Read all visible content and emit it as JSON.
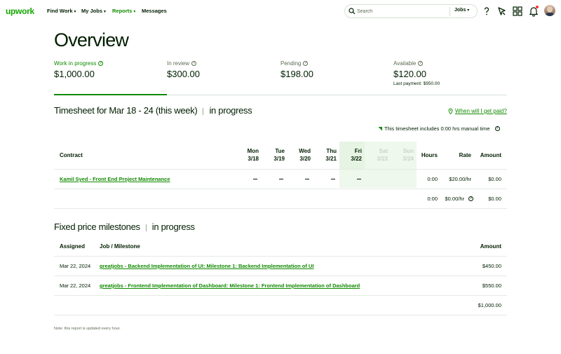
{
  "nav": {
    "logo": "upwork",
    "find_work": "Find Work",
    "my_jobs": "My Jobs",
    "reports": "Reports",
    "messages": "Messages",
    "search_placeholder": "Search",
    "search_scope": "Jobs"
  },
  "overview": {
    "title": "Overview",
    "stats": [
      {
        "label": "Work in progress",
        "value": "$1,000.00",
        "sub": ""
      },
      {
        "label": "In review",
        "value": "$300.00",
        "sub": ""
      },
      {
        "label": "Pending",
        "value": "$198.00",
        "sub": ""
      },
      {
        "label": "Available",
        "value": "$120.00",
        "sub": "Last payment: $950.00"
      }
    ]
  },
  "timesheet": {
    "title": "Timesheet for Mar 18 - 24 (this week)",
    "status": "in progress",
    "help_link": "When will I get paid?",
    "manual_note": "This timesheet includes 0:00 hrs manual time",
    "columns": {
      "contract": "Contract",
      "days": [
        {
          "day": "Mon",
          "date": "3/18"
        },
        {
          "day": "Tue",
          "date": "3/19"
        },
        {
          "day": "Wed",
          "date": "3/20"
        },
        {
          "day": "Thu",
          "date": "3/21"
        },
        {
          "day": "Fri",
          "date": "3/22"
        },
        {
          "day": "Sat",
          "date": "3/23"
        },
        {
          "day": "Sun",
          "date": "3/24"
        }
      ],
      "hours": "Hours",
      "rate": "Rate",
      "amount": "Amount"
    },
    "row": {
      "contract": "Kamil Syed - Front End Project Maintenance",
      "hours": "0:00",
      "rate": "$20.00/hr",
      "amount": "$0.00"
    },
    "totals": {
      "hours": "0:00",
      "rate": "$0.00/hr",
      "amount": "$0.00"
    }
  },
  "milestones": {
    "title": "Fixed price milestones",
    "status": "in progress",
    "columns": {
      "assigned": "Assigned",
      "job": "Job / Milestone",
      "amount": "Amount"
    },
    "rows": [
      {
        "assigned": "Mar 22, 2024",
        "job": "greatjobs - Backend Implementation of UI: Milestone 1: Backend Implementation of UI",
        "amount": "$450.00"
      },
      {
        "assigned": "Mar 22, 2024",
        "job": "greatjobs - Frontend Implementation of Dashboard: Milestone 1: Frontend Implementation of Dashboard",
        "amount": "$550.00"
      }
    ],
    "total": "$1,000.00"
  },
  "footnote": "Note: this report is updated every hour.",
  "colors": {
    "brand": "#14a800",
    "link": "#108a00",
    "text": "#001e00"
  },
  "icons": [
    "search-icon",
    "help-icon",
    "direct-contracts-icon",
    "apps-grid-icon",
    "bell-icon",
    "avatar",
    "question-circle-icon",
    "location-pin-icon"
  ]
}
